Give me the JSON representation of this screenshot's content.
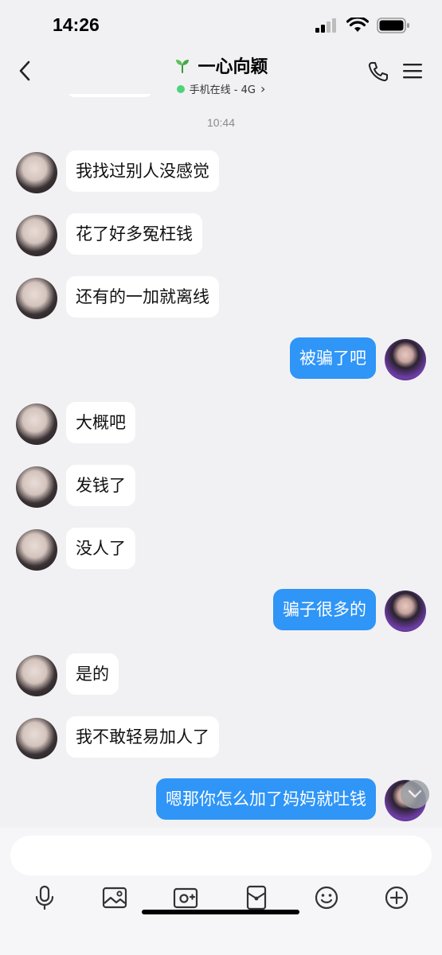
{
  "status_bar": {
    "time": "14:26"
  },
  "header": {
    "title": "一心向颖",
    "online_status": "手机在线 - 4G",
    "chevron": "›"
  },
  "timestamp": "10:44",
  "messages": [
    {
      "side": "in",
      "text": "我找过别人没感觉"
    },
    {
      "side": "in",
      "text": "花了好多冤枉钱"
    },
    {
      "side": "in",
      "text": "还有的一加就离线"
    },
    {
      "side": "out",
      "text": "被骗了吧"
    },
    {
      "side": "in",
      "text": "大概吧"
    },
    {
      "side": "in",
      "text": "发钱了"
    },
    {
      "side": "in",
      "text": "没人了"
    },
    {
      "side": "out",
      "text": "骗子很多的"
    },
    {
      "side": "in",
      "text": "是的"
    },
    {
      "side": "in",
      "text": "我不敢轻易加人了"
    },
    {
      "side": "out",
      "text": "嗯那你怎么加了妈妈就吐钱"
    }
  ],
  "input": {
    "value": "",
    "placeholder": ""
  },
  "toolbar": {
    "icons": [
      "microphone-icon",
      "image-icon",
      "camera-icon",
      "red-packet-icon",
      "emoji-icon",
      "plus-icon"
    ]
  },
  "colors": {
    "background": "#f1f1f3",
    "outgoing_bubble": "#2f95f7",
    "incoming_bubble": "#ffffff",
    "online_dot": "#4cd47a"
  }
}
